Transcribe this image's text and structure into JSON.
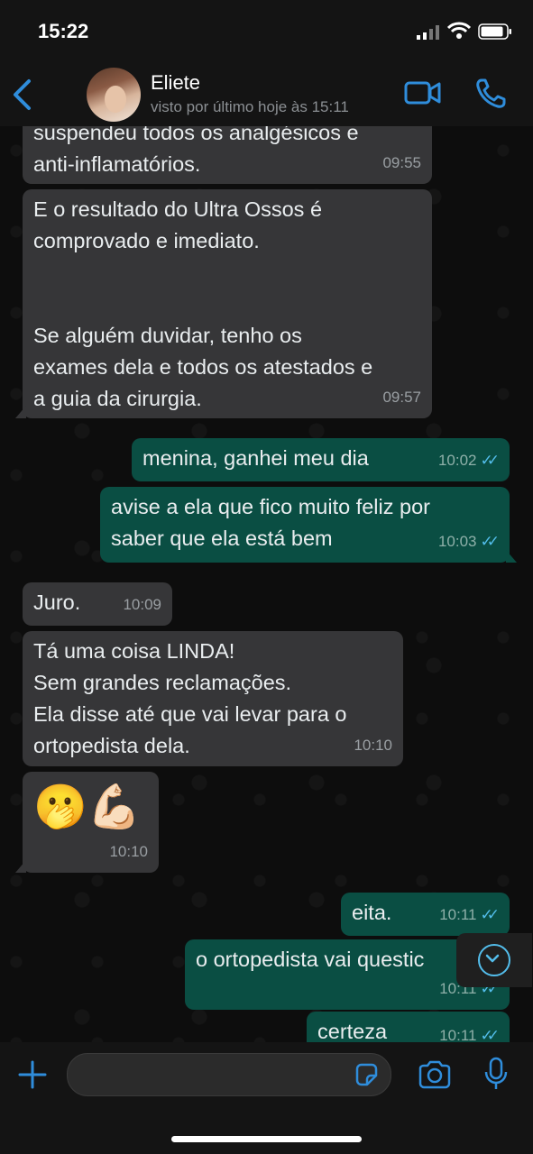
{
  "status_bar": {
    "time": "15:22"
  },
  "header": {
    "contact_name": "Eliete",
    "last_seen": "visto por último hoje às 15:11"
  },
  "messages": [
    {
      "direction": "in",
      "text": "suspendeu todos os analgésicos e\nanti-inflamatórios.",
      "time": "09:55"
    },
    {
      "direction": "in",
      "text": "E o resultado do Ultra Ossos é\ncomprovado e imediato.\n\n\nSe alguém duvidar, tenho os\nexames dela e todos os atestados e\na guia da cirurgia.",
      "time": "09:57"
    },
    {
      "direction": "out",
      "text": "menina, ganhei meu dia",
      "time": "10:02"
    },
    {
      "direction": "out",
      "text": "avise a ela que fico muito feliz por\nsaber que ela está bem",
      "time": "10:03"
    },
    {
      "direction": "in",
      "text": "Juro.",
      "time": "10:09"
    },
    {
      "direction": "in",
      "text": "Tá uma coisa LINDA!\nSem grandes reclamações.\nEla disse até que vai levar para o\nortopedista dela.",
      "time": "10:10"
    },
    {
      "direction": "in",
      "text": "🫢💪🏻",
      "time": "10:10"
    },
    {
      "direction": "out",
      "text": "eita.",
      "time": "10:11"
    },
    {
      "direction": "out",
      "text": "o ortopedista vai questic",
      "time": "10:11"
    },
    {
      "direction": "out",
      "text": "certeza",
      "time": "10:11"
    }
  ],
  "icons": {
    "back": "chevron-left-icon",
    "video": "video-camera-icon",
    "call": "phone-icon",
    "scroll": "chevron-down-icon",
    "plus": "plus-icon",
    "sticker": "sticker-icon",
    "camera": "camera-icon",
    "mic": "microphone-icon"
  },
  "colors": {
    "accent": "#53bdeb",
    "incoming_bubble": "#363638",
    "outgoing_bubble": "#0a4e43"
  }
}
